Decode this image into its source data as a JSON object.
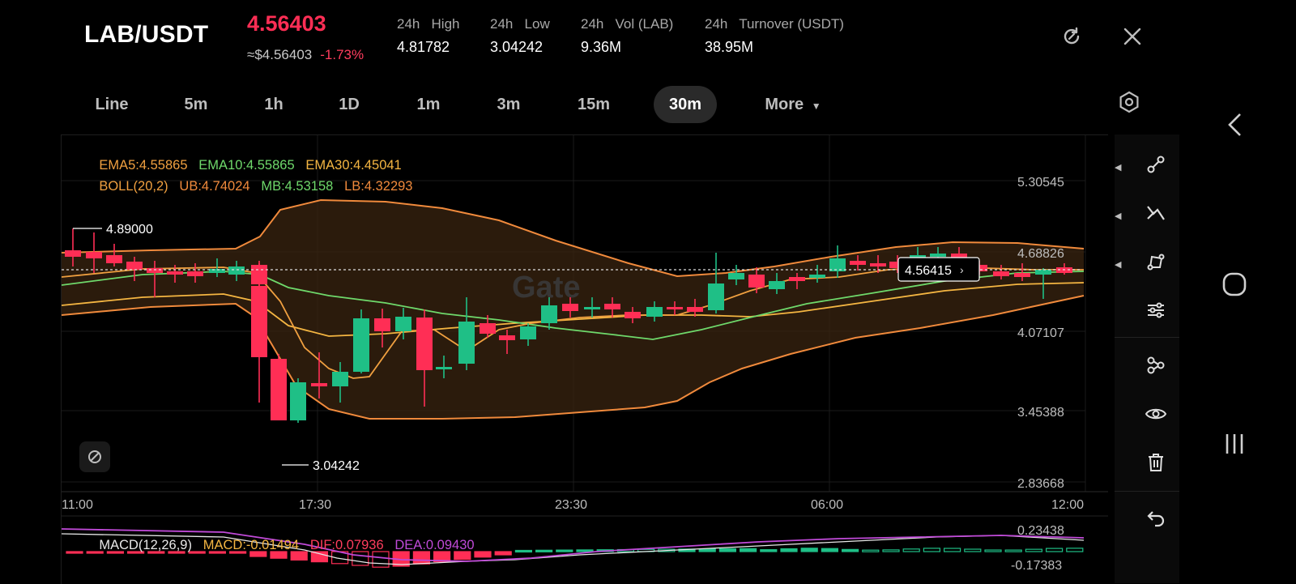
{
  "header": {
    "pair": "LAB/USDT",
    "last_price": "4.56403",
    "fiat_price": "≈$4.56403",
    "change": "-1.73%",
    "stats": [
      {
        "label": "24h   High",
        "value": "4.81782"
      },
      {
        "label": "24h   Low",
        "value": "3.04242"
      },
      {
        "label": "24h   Vol (LAB)",
        "value": "9.36M"
      },
      {
        "label": "24h   Turnover (USDT)",
        "value": "38.95M"
      }
    ]
  },
  "tabs": [
    {
      "label": "Line"
    },
    {
      "label": "5m"
    },
    {
      "label": "1h"
    },
    {
      "label": "1D"
    },
    {
      "label": "1m"
    },
    {
      "label": "3m"
    },
    {
      "label": "15m"
    },
    {
      "label": "30m"
    },
    {
      "label": "More"
    }
  ],
  "active_tab": "30m",
  "indicators": {
    "ema5": "EMA5:4.55865",
    "ema10": "EMA10:4.55865",
    "ema30": "EMA30:4.45041",
    "boll": "BOLL(20,2)",
    "ub": "UB:4.74024",
    "mb": "MB:4.53158",
    "lb": "LB:4.32293"
  },
  "price_axis": [
    "5.30545",
    "4.68826",
    "4.07107",
    "3.45388",
    "2.83668"
  ],
  "time_axis": [
    "11:00",
    "17:30",
    "23:30",
    "06:00",
    "12:00"
  ],
  "high_marker": "4.89000",
  "low_marker": "3.04242",
  "current_price_label": "4.56415",
  "watermark": "Gate",
  "macd": {
    "title": "MACD(12,26,9)",
    "macd": "MACD:-0.01494",
    "dif": "DIF:0.07936",
    "dea": "DEA:0.09430",
    "axis": [
      "0.23438",
      "-0.17383"
    ]
  },
  "colors": {
    "up": "#1fbf86",
    "down": "#ff2e55",
    "ema5": "#f0a040",
    "ema10": "#6fd96b",
    "ema30": "#f5b642",
    "boll": "#f08a3c",
    "dea": "#c04ad8"
  },
  "icons": {
    "refresh": "refresh-icon",
    "close": "close-icon",
    "settings": "settings-icon",
    "toolbar": [
      "line-tool-icon",
      "trend-tool-icon",
      "shape-tool-icon",
      "sliders-icon",
      "indicator-icon",
      "eye-icon",
      "trash-icon",
      "undo-icon"
    ],
    "nav": [
      "back-icon",
      "home-icon",
      "recents-icon"
    ]
  }
}
